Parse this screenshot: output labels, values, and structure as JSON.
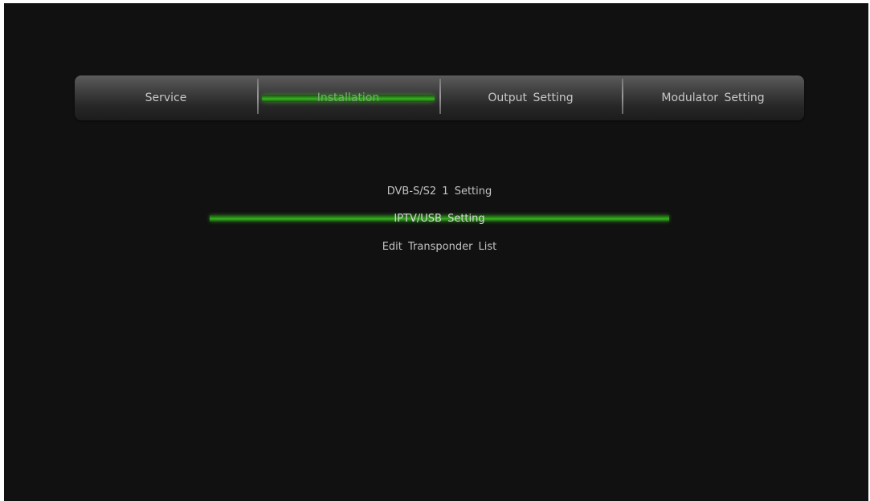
{
  "tabs": [
    {
      "label": "Service",
      "selected": false
    },
    {
      "label": "Installation",
      "selected": true
    },
    {
      "label": "Output Setting",
      "selected": false
    },
    {
      "label": "Modulator Setting",
      "selected": false
    }
  ],
  "menu": {
    "items": [
      {
        "label": "DVB-S/S2 1 Setting",
        "selected": false
      },
      {
        "label": "IPTV/USB Setting",
        "selected": true
      },
      {
        "label": "Edit Transponder List",
        "selected": false
      }
    ]
  },
  "colors": {
    "background": "#111111",
    "highlight": "#37b821",
    "text": "#c8c8c8"
  }
}
